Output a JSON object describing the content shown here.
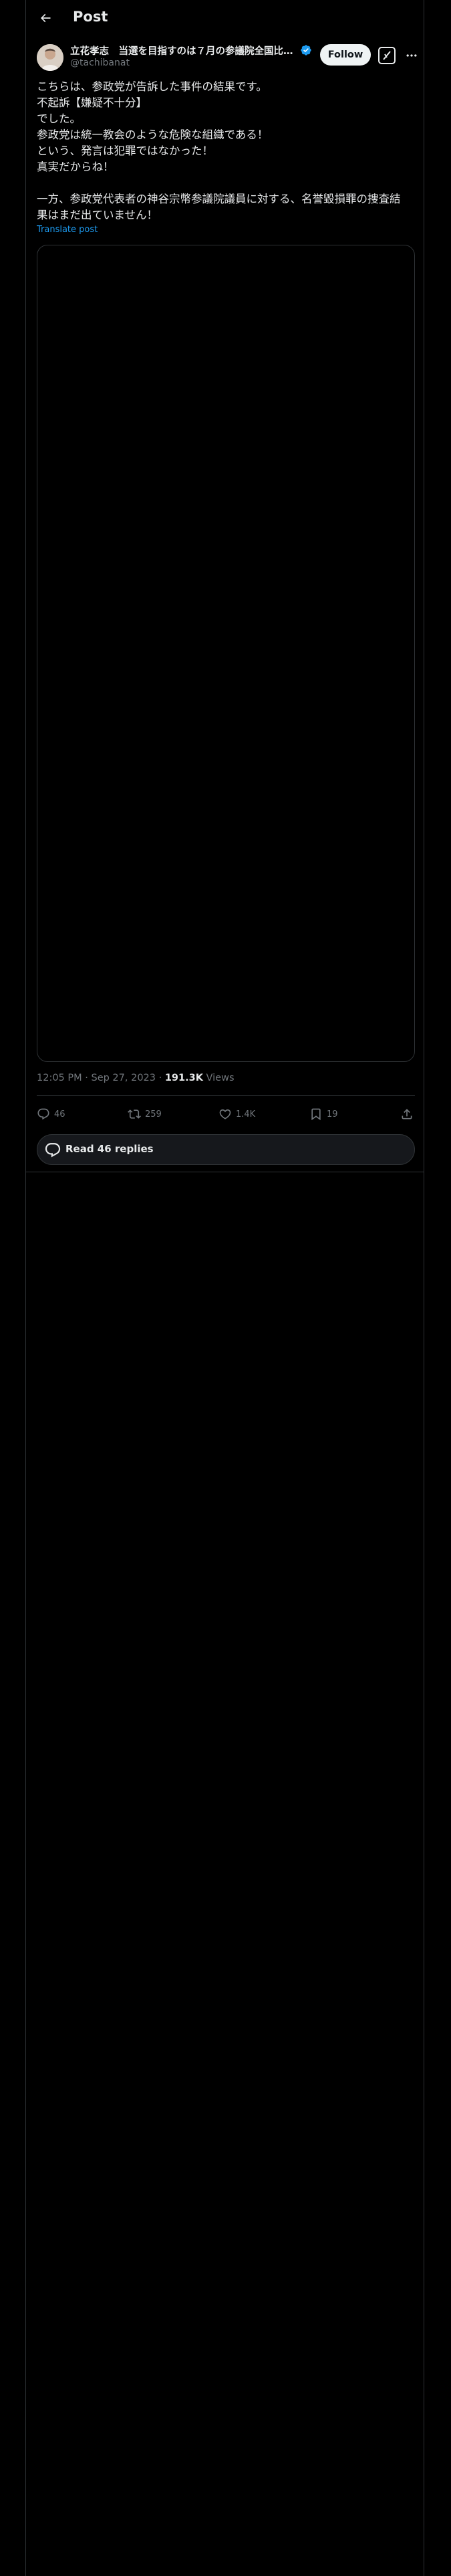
{
  "header": {
    "title": "Post"
  },
  "author": {
    "name": "立花孝志　当選を目指すのは７月の参議院全国比…",
    "handle": "@tachibanat"
  },
  "buttons": {
    "follow": "Follow"
  },
  "post": {
    "lines": [
      "こちらは、参政党が告訴した事件の結果です。",
      "不起訴【嫌疑不十分】",
      "でした。",
      "参政党は統一教会のような危険な組織である！",
      "という、発言は犯罪ではなかった！",
      "真実だからね！",
      "",
      "一方、参政党代表者の神谷宗幣参議院議員に対する、名誉毀損罪の捜査結",
      "果はまだ出ていません！"
    ],
    "translate_label": "Translate post"
  },
  "meta": {
    "time": "12:05 PM",
    "separator1": " · ",
    "date": "Sep 27, 2023",
    "separator2": " · ",
    "views_count": "191.3K",
    "views_label": " Views"
  },
  "actions": {
    "replies": "46",
    "reposts": "259",
    "likes": "1.4K",
    "bookmarks": "19"
  },
  "read_replies": {
    "label": "Read 46 replies"
  },
  "colors": {
    "background": "#000000",
    "text": "#e7e9ea",
    "muted": "#71767b",
    "accent": "#1d9bf0",
    "border": "#2f3336"
  }
}
